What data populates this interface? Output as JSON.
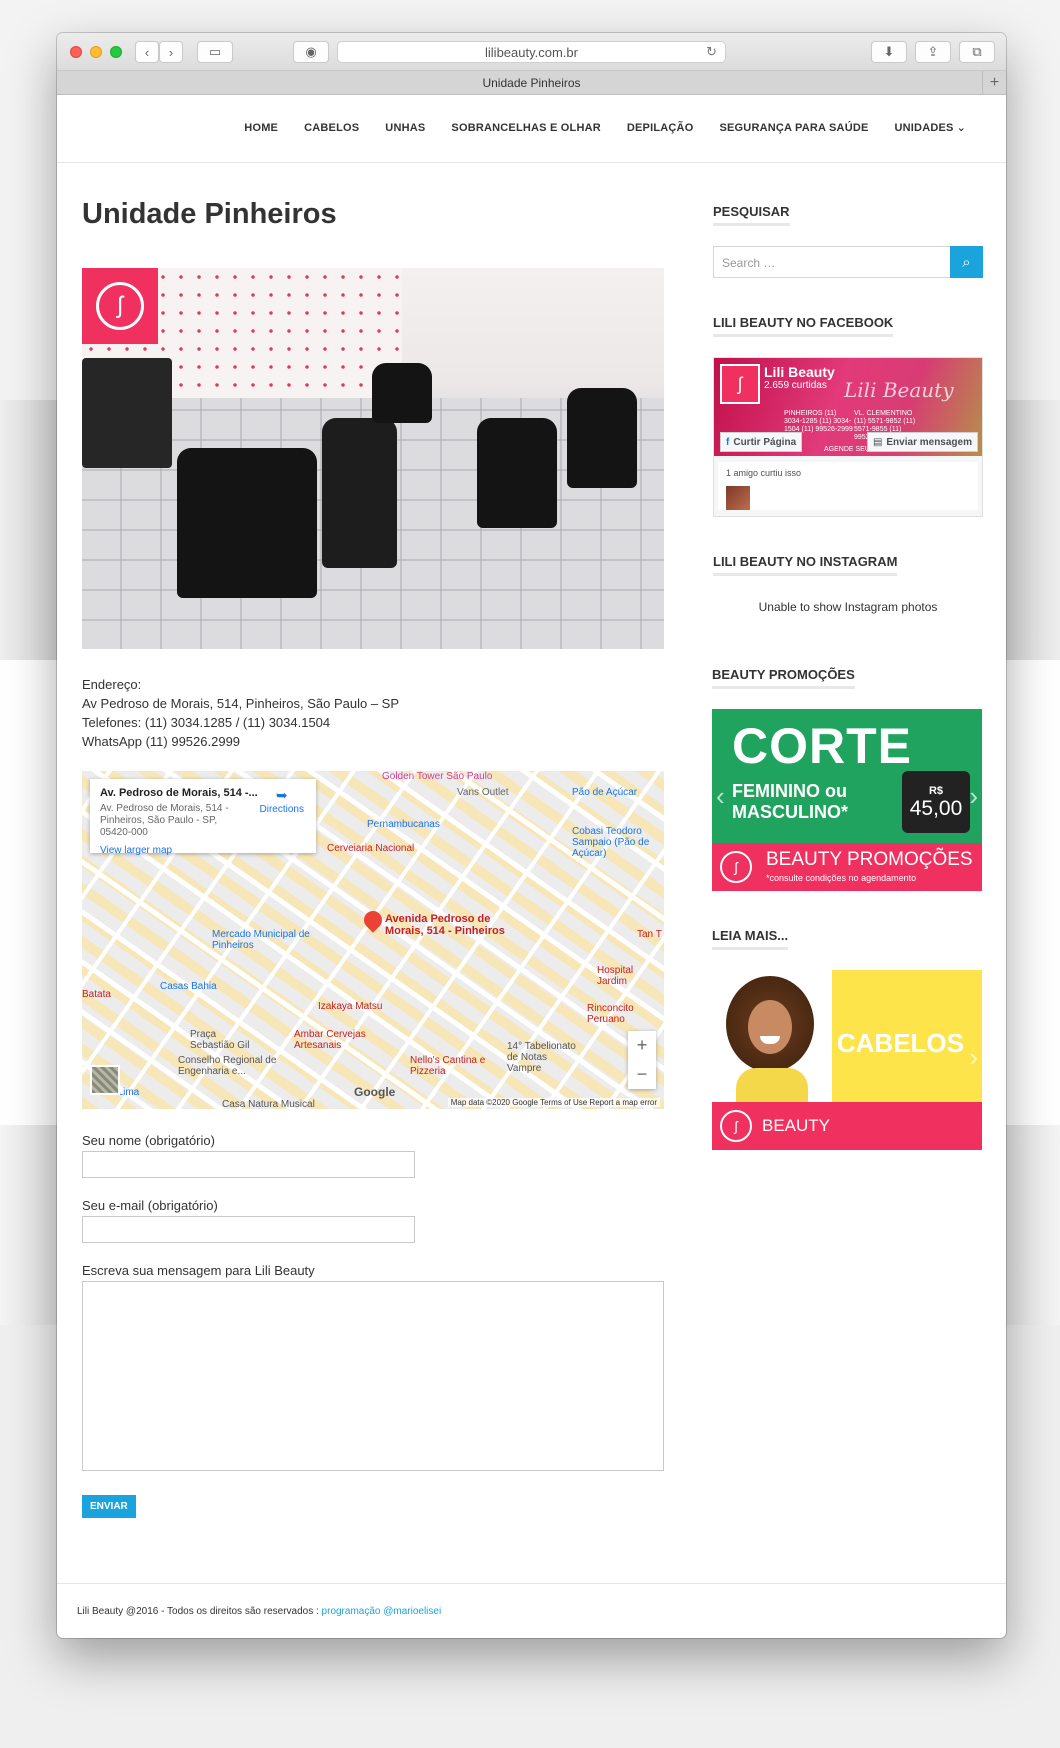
{
  "browser": {
    "url": "lilibeauty.com.br",
    "tab_title": "Unidade Pinheiros"
  },
  "nav": {
    "items": [
      "HOME",
      "CABELOS",
      "UNHAS",
      "SOBRANCELHAS E OLHAR",
      "DEPILAÇÃO",
      "SEGURANÇA PARA SAÚDE",
      "UNIDADES"
    ]
  },
  "page": {
    "title": "Unidade Pinheiros",
    "address_label": "Endereço:",
    "address_line": "Av Pedroso de Morais, 514, Pinheiros, São Paulo – SP",
    "phones": "Telefones: (11) 3034.1285 / (11) 3034.1504",
    "whatsapp": "WhatsApp (11) 99526.2999"
  },
  "map": {
    "card_title": "Av. Pedroso de Morais, 514 -...",
    "card_address": "Av. Pedroso de Morais, 514 - Pinheiros, São Paulo - SP, 05420-000",
    "directions": "Directions",
    "larger_map": "View larger map",
    "pin_label": "Avenida Pedroso de Morais, 514 - Pinheiros",
    "pois": [
      "Golden Tower São Paulo",
      "Vans Outlet",
      "Pão de Açúcar",
      "Pernambucanas",
      "Cerveiaria Nacional",
      "Cobasi Teodoro Sampaio (Pão de Açúcar)",
      "Mercado Municipal de Pinheiros",
      "Casas Bahia",
      "Izakaya Matsu",
      "Ambar Cervejas Artesanais",
      "Hospital Jardim",
      "Rinconcito Peruano",
      "14° Tabelionato de Notas Vampre",
      "Nello's Cantina e Pizzeria",
      "Praça Sebastião Gil",
      "Conselho Regional de Engenharia e...",
      "Faria Lima",
      "Casa Natura Musical",
      "Batata",
      "Tan T"
    ],
    "attribution": "Map data ©2020 Google  Terms of Use  Report a map error",
    "google": "Google",
    "zoom_in": "+",
    "zoom_out": "−"
  },
  "form": {
    "name_label": "Seu nome (obrigatório)",
    "email_label": "Seu e-mail (obrigatório)",
    "message_label": "Escreva sua mensagem para Lili Beauty",
    "submit": "ENVIAR"
  },
  "sidebar": {
    "search_title": "PESQUISAR",
    "search_placeholder": "Search …",
    "facebook_title": "LILI BEAUTY NO FACEBOOK",
    "fb_page_name": "Lili Beauty",
    "fb_likes": "2.659 curtidas",
    "fb_cover_script": "Lili Beauty",
    "fb_addr_1": "PINHEIROS (11) 3034-1285 (11) 3034-1504 (11) 99526-2999",
    "fb_addr_2": "VL. CLEMENTINO (11) 5571-9852 (11) 5571-9855 (11) 99526-2999",
    "fb_addr_3": "AGENDE SEU HORÁRIO!",
    "fb_like_btn": "Curtir Página",
    "fb_msg_btn": "Enviar mensagem",
    "fb_friends": "1 amigo curtiu isso",
    "instagram_title": "LILI BEAUTY NO INSTAGRAM",
    "instagram_msg": "Unable to show Instagram photos",
    "promo_title": "BEAUTY PROMOÇÕES",
    "promo_corte": "CORTE",
    "promo_sub": "FEMININO ou MASCULINO*",
    "promo_rs": "R$",
    "promo_price": "45,00",
    "promo_band": "BEAUTY PROMOÇÕES",
    "promo_note": "*consulte condições no agendamento",
    "leia_title": "LEIA MAIS...",
    "leia_cabelos": "CABELOS",
    "leia_band": "BEAUTY"
  },
  "footer": {
    "text": "Lili Beauty @2016 - Todos os direitos são reservados : ",
    "link": "programação @marioelisei"
  },
  "colors": {
    "accent": "#1ba3dd",
    "brand_pink": "#f0305f",
    "promo_green": "#1fa35e"
  }
}
